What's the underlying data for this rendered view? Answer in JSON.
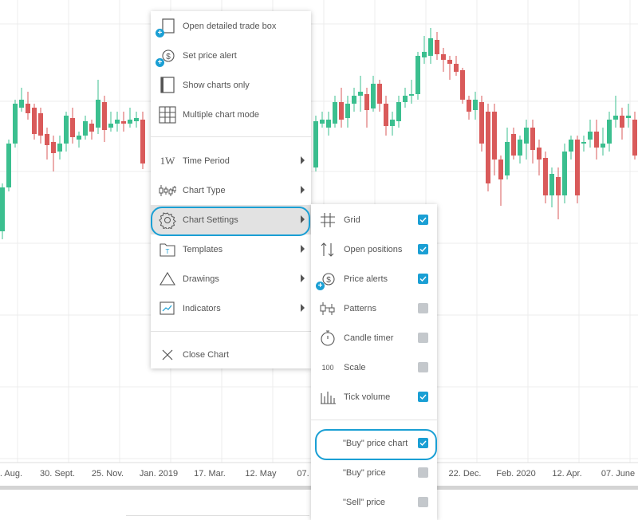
{
  "chart": {
    "x_labels": [
      ". Aug.",
      "30. Sept.",
      "25. Nov.",
      "Jan. 2019",
      "17. Mar.",
      "12. May",
      "07.",
      "22. Dec.",
      "Feb. 2020",
      "12. Apr.",
      "07. June"
    ],
    "colors": {
      "up": "#3bbf8f",
      "down": "#d95a5a",
      "grid": "#ececec"
    }
  },
  "context_menu": {
    "items": [
      {
        "label": "Open detailed trade box",
        "icon": "trade-box-plus-icon"
      },
      {
        "label": "Set price alert",
        "icon": "price-alert-plus-icon"
      },
      {
        "label": "Show charts only",
        "icon": "charts-only-icon"
      },
      {
        "label": "Multiple chart mode",
        "icon": "grid-layout-icon"
      },
      {
        "label": "Time Period",
        "icon": "time-period-icon",
        "icon_text": "1W",
        "submenu": true
      },
      {
        "label": "Chart Type",
        "icon": "candlestick-icon",
        "submenu": true
      },
      {
        "label": "Chart Settings",
        "icon": "gear-icon",
        "submenu": true,
        "active": true
      },
      {
        "label": "Templates",
        "icon": "templates-icon",
        "submenu": true
      },
      {
        "label": "Drawings",
        "icon": "triangle-icon",
        "submenu": true
      },
      {
        "label": "Indicators",
        "icon": "indicators-icon",
        "submenu": true
      },
      {
        "label": "Close Chart",
        "icon": "close-icon"
      }
    ]
  },
  "settings_menu": {
    "items": [
      {
        "label": "Grid",
        "icon": "grid-icon",
        "checked": true
      },
      {
        "label": "Open positions",
        "icon": "up-down-arrows-icon",
        "checked": true
      },
      {
        "label": "Price alerts",
        "icon": "price-alert-plus-icon",
        "checked": true
      },
      {
        "label": "Patterns",
        "icon": "patterns-icon",
        "checked": false
      },
      {
        "label": "Candle timer",
        "icon": "stopwatch-icon",
        "checked": false
      },
      {
        "label": "Scale",
        "icon": "scale-icon",
        "icon_text": "100",
        "checked": false
      },
      {
        "label": "Tick volume",
        "icon": "volume-bars-icon",
        "checked": true
      },
      {
        "label": "\"Buy\" price chart",
        "checked": true
      },
      {
        "label": "\"Buy\" price",
        "checked": false
      },
      {
        "label": "\"Sell\" price",
        "checked": false
      }
    ]
  }
}
